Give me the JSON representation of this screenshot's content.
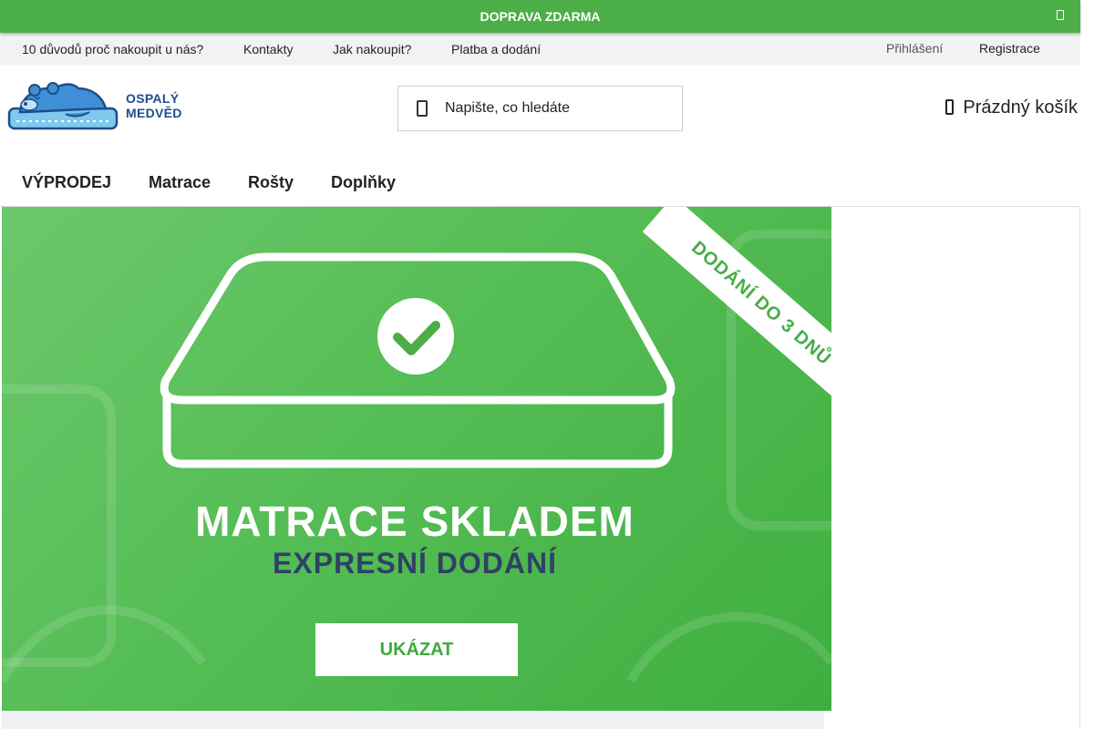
{
  "promo": {
    "text": "DOPRAVA ZDARMA"
  },
  "top_links": {
    "items": [
      "10 důvodů proč nakoupit u nás?",
      "Kontakty",
      "Jak nakoupit?",
      "Platba a dodání"
    ],
    "login": "Přihlášení",
    "register": "Registrace"
  },
  "header": {
    "logo_line1": "OSPALÝ",
    "logo_line2": "MEDVĚD",
    "search_placeholder": "Napište, co hledáte",
    "cart_label": "Prázdný košík"
  },
  "nav": {
    "items": [
      "VÝPRODEJ",
      "Matrace",
      "Rošty",
      "Doplňky"
    ]
  },
  "banner": {
    "ribbon": "DODÁNÍ DO 3 DNŮ",
    "title": "MATRACE SKLADEM",
    "subtitle": "EXPRESNÍ DODÁNÍ",
    "button": "UKÁZAT"
  },
  "colors": {
    "green": "#4cae46",
    "logo_blue": "#1d4e8a",
    "subtitle_navy": "#2f4166"
  }
}
